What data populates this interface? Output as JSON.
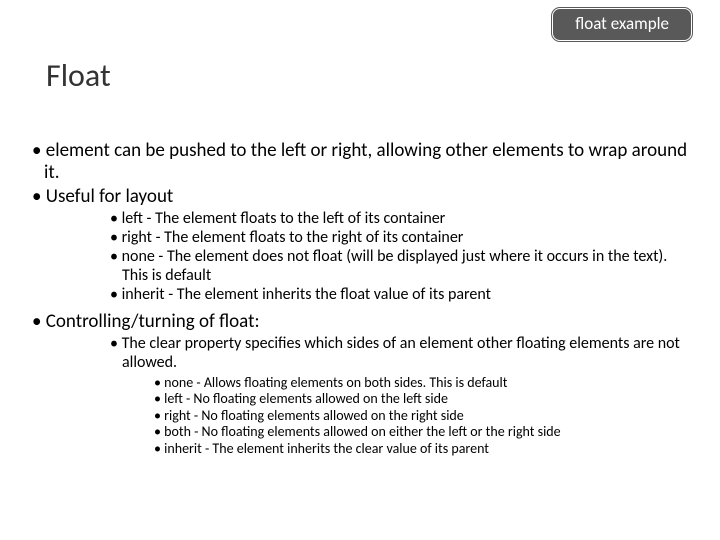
{
  "badge": "float example",
  "title": "Float",
  "bullets": {
    "p1": "element can be pushed to the left or right, allowing other elements to wrap around it.",
    "p2": "Useful for layout",
    "p2a": "left - The element floats to the left of its container",
    "p2b": "right - The element floats to the right of its container",
    "p2c": "none - The element does not float (will be displayed just where it occurs in the text). This is default",
    "p2d": "inherit - The element inherits the float value of its parent",
    "p3": "Controlling/turning of float:",
    "p3a": "The clear property specifies which sides of an element other floating elements are not allowed.",
    "p3a1": "none - Allows floating elements on both sides. This is default",
    "p3a2": "left - No floating elements allowed on the left side",
    "p3a3": "right - No floating elements allowed on the right side",
    "p3a4": "both - No floating elements allowed on either the left or the right side",
    "p3a5": "inherit - The element inherits the clear value of its parent"
  }
}
